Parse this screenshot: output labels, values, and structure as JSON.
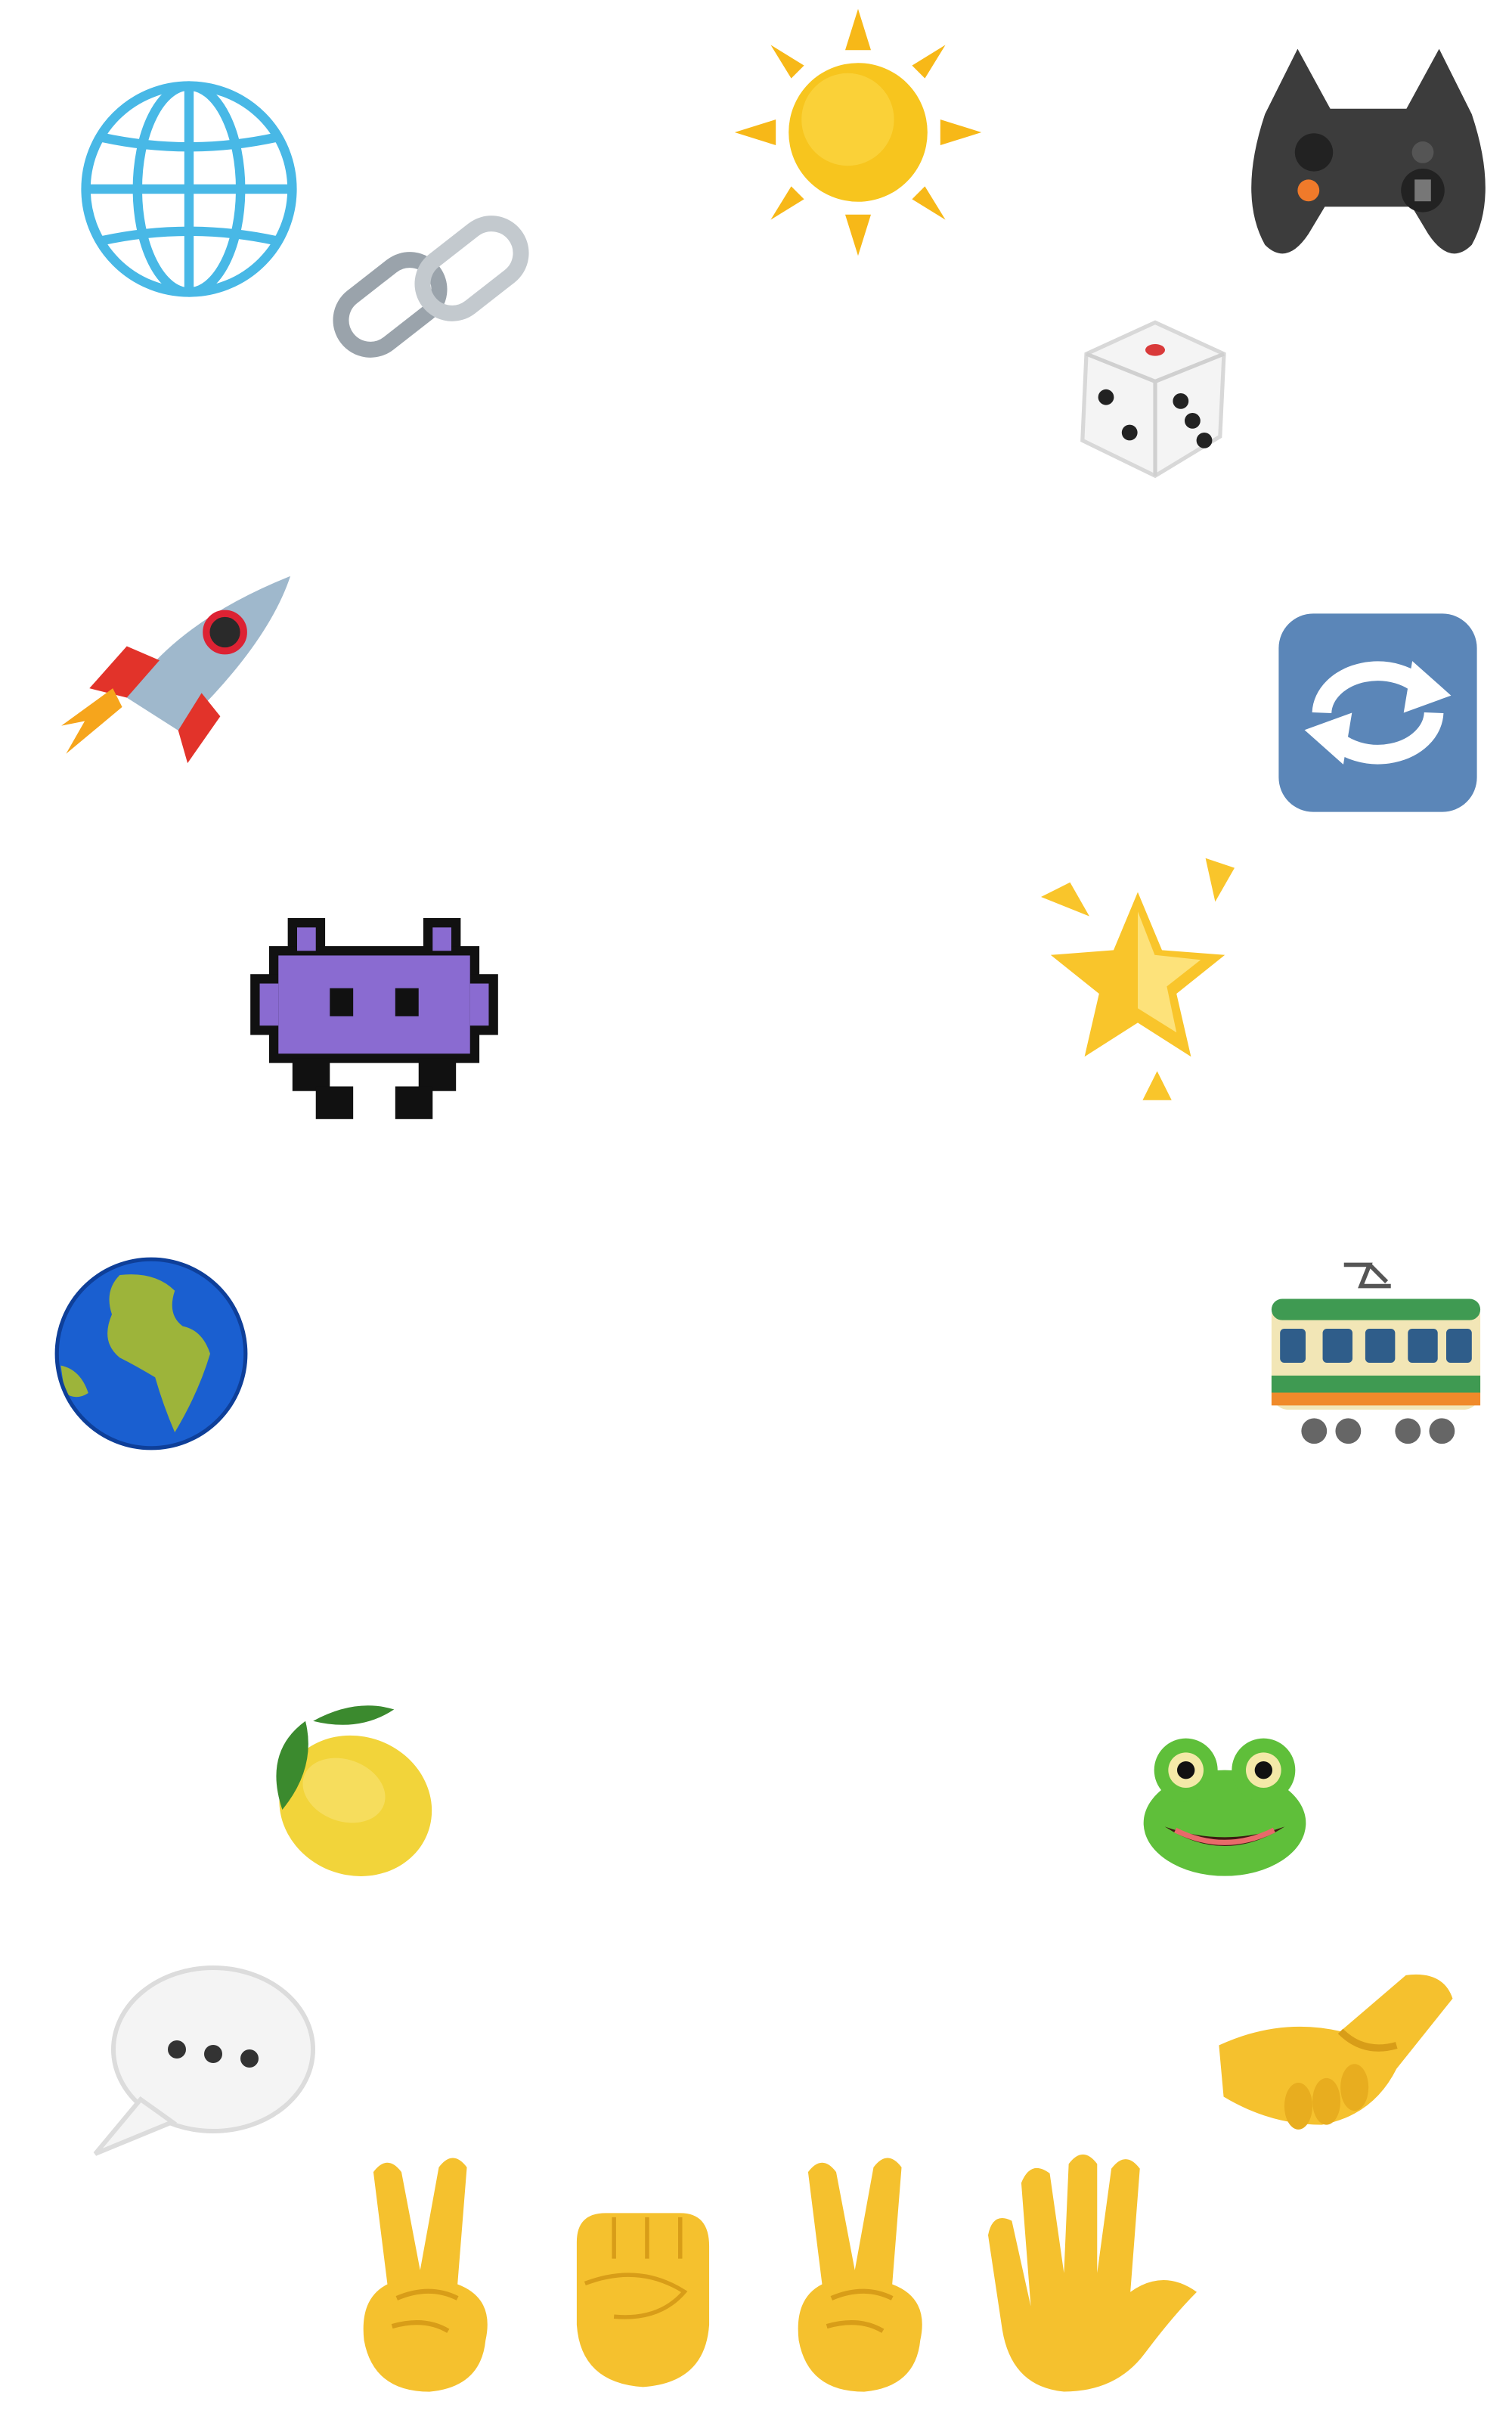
{
  "emojis": [
    {
      "id": "globe-grid",
      "name": "globe-with-meridians-icon"
    },
    {
      "id": "link",
      "name": "link-icon"
    },
    {
      "id": "sun",
      "name": "sun-icon"
    },
    {
      "id": "gamepad",
      "name": "video-game-controller-icon"
    },
    {
      "id": "die",
      "name": "game-die-icon"
    },
    {
      "id": "rocket",
      "name": "rocket-icon"
    },
    {
      "id": "refresh",
      "name": "counterclockwise-arrows-button-icon"
    },
    {
      "id": "invader",
      "name": "alien-monster-icon"
    },
    {
      "id": "star",
      "name": "glowing-star-icon"
    },
    {
      "id": "earth",
      "name": "globe-europe-africa-icon"
    },
    {
      "id": "tram",
      "name": "tram-car-icon"
    },
    {
      "id": "lemon",
      "name": "lemon-icon"
    },
    {
      "id": "frog",
      "name": "frog-icon"
    },
    {
      "id": "speech",
      "name": "speech-balloon-icon"
    },
    {
      "id": "handshake",
      "name": "handshake-icon"
    },
    {
      "id": "victory1",
      "name": "victory-hand-icon"
    },
    {
      "id": "fist",
      "name": "raised-fist-icon"
    },
    {
      "id": "victory2",
      "name": "victory-hand-icon"
    },
    {
      "id": "vulcan",
      "name": "vulcan-salute-icon"
    }
  ],
  "colors": {
    "background": "#ffffff",
    "sun": "#f7c51e",
    "globe_blue": "#48b8e6",
    "earth_ocean": "#1a5fd0",
    "earth_land": "#9db43a",
    "invader_purple": "#8a6bd1",
    "refresh_blue": "#5b86b8",
    "tram_green": "#3f9a52",
    "lemon": "#f2d43a",
    "frog_green": "#5fbf3a",
    "hand_yellow": "#f5c12e",
    "die_white": "#f4f4f4",
    "dot_red": "#d93a3a"
  }
}
